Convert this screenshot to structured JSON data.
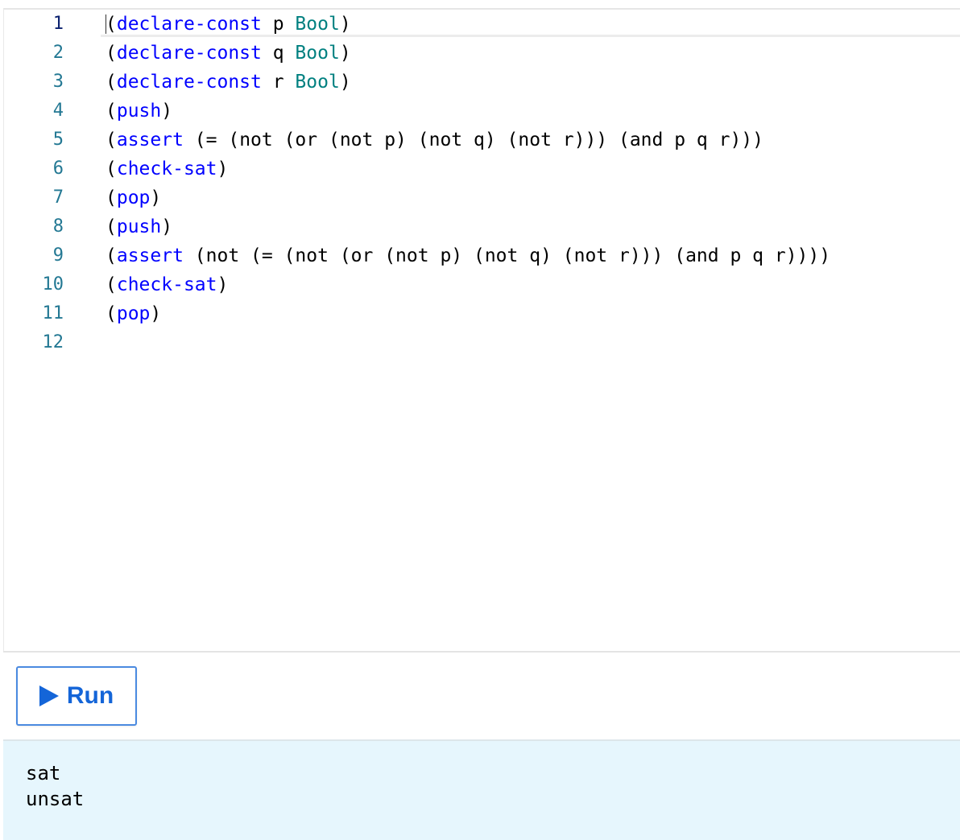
{
  "editor": {
    "lines": [
      {
        "num": "1",
        "tokens": [
          {
            "t": "(",
            "c": "p"
          },
          {
            "t": "declare-const",
            "c": "kw"
          },
          {
            "t": " p ",
            "c": "p"
          },
          {
            "t": "Bool",
            "c": "ty"
          },
          {
            "t": ")",
            "c": "p"
          }
        ]
      },
      {
        "num": "2",
        "tokens": [
          {
            "t": "(",
            "c": "p"
          },
          {
            "t": "declare-const",
            "c": "kw"
          },
          {
            "t": " q ",
            "c": "p"
          },
          {
            "t": "Bool",
            "c": "ty"
          },
          {
            "t": ")",
            "c": "p"
          }
        ]
      },
      {
        "num": "3",
        "tokens": [
          {
            "t": "(",
            "c": "p"
          },
          {
            "t": "declare-const",
            "c": "kw"
          },
          {
            "t": " r ",
            "c": "p"
          },
          {
            "t": "Bool",
            "c": "ty"
          },
          {
            "t": ")",
            "c": "p"
          }
        ]
      },
      {
        "num": "4",
        "tokens": [
          {
            "t": "(",
            "c": "p"
          },
          {
            "t": "push",
            "c": "kw"
          },
          {
            "t": ")",
            "c": "p"
          }
        ]
      },
      {
        "num": "5",
        "tokens": [
          {
            "t": "(",
            "c": "p"
          },
          {
            "t": "assert",
            "c": "kw"
          },
          {
            "t": " (= (not (or (not p) (not q) (not r))) (and p q r)))",
            "c": "p"
          }
        ]
      },
      {
        "num": "6",
        "tokens": [
          {
            "t": "(",
            "c": "p"
          },
          {
            "t": "check-sat",
            "c": "kw"
          },
          {
            "t": ")",
            "c": "p"
          }
        ]
      },
      {
        "num": "7",
        "tokens": [
          {
            "t": "(",
            "c": "p"
          },
          {
            "t": "pop",
            "c": "kw"
          },
          {
            "t": ")",
            "c": "p"
          }
        ]
      },
      {
        "num": "8",
        "tokens": [
          {
            "t": "(",
            "c": "p"
          },
          {
            "t": "push",
            "c": "kw"
          },
          {
            "t": ")",
            "c": "p"
          }
        ]
      },
      {
        "num": "9",
        "tokens": [
          {
            "t": "(",
            "c": "p"
          },
          {
            "t": "assert",
            "c": "kw"
          },
          {
            "t": " (not (= (not (or (not p) (not q) (not r))) (and p q r))))",
            "c": "p"
          }
        ]
      },
      {
        "num": "10",
        "tokens": [
          {
            "t": "(",
            "c": "p"
          },
          {
            "t": "check-sat",
            "c": "kw"
          },
          {
            "t": ")",
            "c": "p"
          }
        ]
      },
      {
        "num": "11",
        "tokens": [
          {
            "t": "(",
            "c": "p"
          },
          {
            "t": "pop",
            "c": "kw"
          },
          {
            "t": ")",
            "c": "p"
          }
        ]
      },
      {
        "num": "12",
        "tokens": []
      }
    ]
  },
  "toolbar": {
    "run_label": "Run",
    "run_icon": "play-icon"
  },
  "output": {
    "lines": [
      "sat",
      "unsat"
    ]
  },
  "colors": {
    "keyword": "#0000ff",
    "type": "#008080",
    "line_number": "#237893",
    "run_accent": "#1465d8",
    "output_bg": "#e6f6fd"
  }
}
